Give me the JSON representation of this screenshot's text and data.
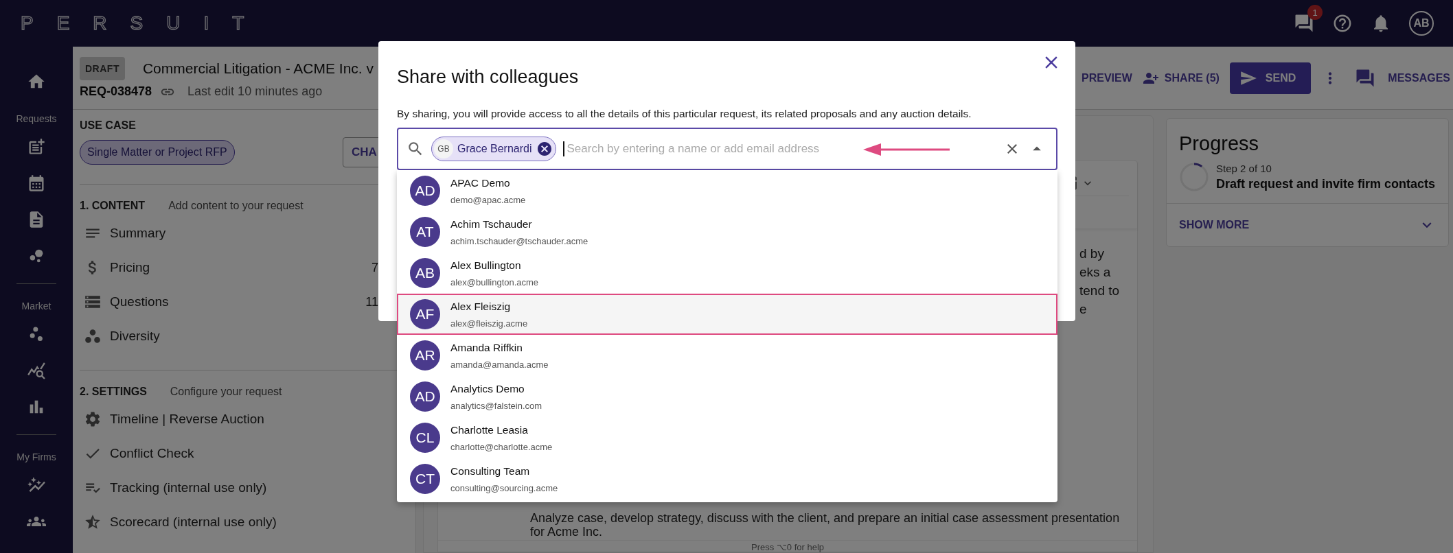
{
  "top_bar": {
    "logo": "PERSUIT",
    "messages_badge": "1",
    "avatar": "AB"
  },
  "nav": {
    "sections": [
      {
        "label": "Requests"
      },
      {
        "label": "Market"
      },
      {
        "label": "My Firms"
      }
    ]
  },
  "request": {
    "status": "DRAFT",
    "title": "Commercial Litigation - ACME Inc. v",
    "id": "REQ-038478",
    "last_edit": "Last edit 10 minutes ago"
  },
  "actions": {
    "preview": "PREVIEW",
    "share": "SHARE (5)",
    "send": "SEND",
    "messages": "MESSAGES"
  },
  "use_case": {
    "heading": "USE CASE",
    "value": "Single Matter or Project RFP",
    "button": "CHA"
  },
  "sections": [
    {
      "heading": "1. CONTENT",
      "hint": "Add content to your request",
      "items": [
        {
          "label": "Summary"
        },
        {
          "label": "Pricing",
          "count": "7"
        },
        {
          "label": "Questions",
          "count": "11"
        },
        {
          "label": "Diversity"
        }
      ]
    },
    {
      "heading": "2. SETTINGS",
      "hint": "Configure your request",
      "items": [
        {
          "label": "Timeline | Reverse Auction"
        },
        {
          "label": "Conflict Check"
        },
        {
          "label": "Tracking (internal use only)"
        },
        {
          "label": "Scorecard (internal use only)"
        }
      ]
    }
  ],
  "editor": {
    "fragments": [
      "d by",
      "eks a",
      "tend to",
      "e"
    ],
    "bullet": "Analyze case, develop strategy, discuss with the client, and prepare an initial case assessment presentation for Acme Inc.",
    "help": "Press ⌥0 for help"
  },
  "progress": {
    "title": "Progress",
    "step": "Step 2 of 10",
    "level": 0.1,
    "description": "Draft request and invite firm contacts",
    "toggle": "SHOW MORE"
  },
  "modal": {
    "title": "Share with colleagues",
    "description": "By sharing, you will provide access to all the details of this particular request, its related proposals and any auction details.",
    "chips": [
      {
        "initials": "GB",
        "name": "Grace Bernardi"
      }
    ],
    "placeholder": "Search by entering a name or add email address",
    "options": [
      {
        "initials": "AD",
        "name": "APAC Demo",
        "email": "demo@apac.acme",
        "selected": false
      },
      {
        "initials": "AT",
        "name": "Achim Tschauder",
        "email": "achim.tschauder@tschauder.acme",
        "selected": false
      },
      {
        "initials": "AB",
        "name": "Alex Bullington",
        "email": "alex@bullington.acme",
        "selected": false
      },
      {
        "initials": "AF",
        "name": "Alex Fleiszig",
        "email": "alex@fleiszig.acme",
        "selected": true
      },
      {
        "initials": "AR",
        "name": "Amanda Riffkin",
        "email": "amanda@amanda.acme",
        "selected": false
      },
      {
        "initials": "AD",
        "name": "Analytics Demo",
        "email": "analytics@falstein.com",
        "selected": false
      },
      {
        "initials": "CL",
        "name": "Charlotte Leasia",
        "email": "charlotte@charlotte.acme",
        "selected": false
      },
      {
        "initials": "CT",
        "name": "Consulting Team",
        "email": "consulting@sourcing.acme",
        "selected": false
      }
    ]
  }
}
